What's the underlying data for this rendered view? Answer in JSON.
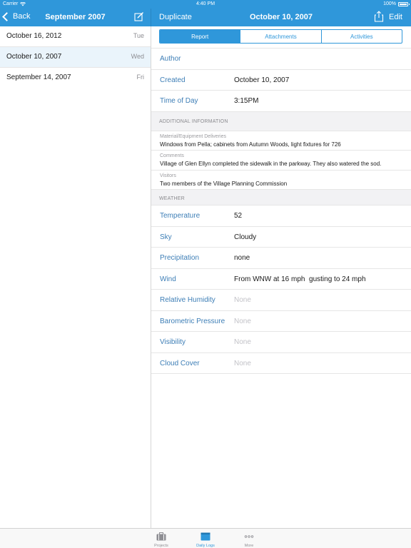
{
  "status_bar": {
    "carrier": "Carrier",
    "time": "4:40 PM",
    "battery": "100%"
  },
  "left_header": {
    "back_label": "Back",
    "title": "September 2007"
  },
  "right_header": {
    "duplicate_label": "Duplicate",
    "title": "October 10, 2007",
    "edit_label": "Edit"
  },
  "log_list": [
    {
      "date": "October 16, 2012",
      "day": "Tue",
      "selected": false
    },
    {
      "date": "October 10, 2007",
      "day": "Wed",
      "selected": true
    },
    {
      "date": "September 14, 2007",
      "day": "Fri",
      "selected": false
    }
  ],
  "tabs": {
    "report": "Report",
    "attachments": "Attachments",
    "activities": "Activities",
    "active": "report"
  },
  "report": {
    "author_label": "Author",
    "author_value": "",
    "created_label": "Created",
    "created_value": "October 10, 2007",
    "time_label": "Time of Day",
    "time_value": "3:15PM"
  },
  "additional_info": {
    "header": "ADDITIONAL INFORMATION",
    "material_label": "Material/Equipment Deliveries",
    "material_value": "Windows from Pella; cabinets from Autumn Woods, light fixtures for 726",
    "comments_label": "Comments",
    "comments_value": "Village of Glen Ellyn completed the sidewalk in the parkway. They also watered the sod.",
    "visitors_label": "Visitors",
    "visitors_value": "Two members of the Village Planning Commission"
  },
  "weather": {
    "header": "WEATHER",
    "temperature_label": "Temperature",
    "temperature_value": "52",
    "sky_label": "Sky",
    "sky_value": "Cloudy",
    "precipitation_label": "Precipitation",
    "precipitation_value": "none",
    "wind_label": "Wind",
    "wind_value": "From WNW at 16 mph  gusting to 24 mph",
    "humidity_label": "Relative Humidity",
    "humidity_value": "None",
    "pressure_label": "Barometric Pressure",
    "pressure_value": "None",
    "visibility_label": "Visibility",
    "visibility_value": "None",
    "cloud_label": "Cloud Cover",
    "cloud_value": "None"
  },
  "tab_bar": {
    "projects": "Projects",
    "daily_logs": "Daily Logs",
    "more": "More",
    "active": "daily_logs"
  },
  "colors": {
    "accent": "#2f97da",
    "label_blue": "#3d7eb6",
    "selected_row": "#eaf4fb"
  }
}
